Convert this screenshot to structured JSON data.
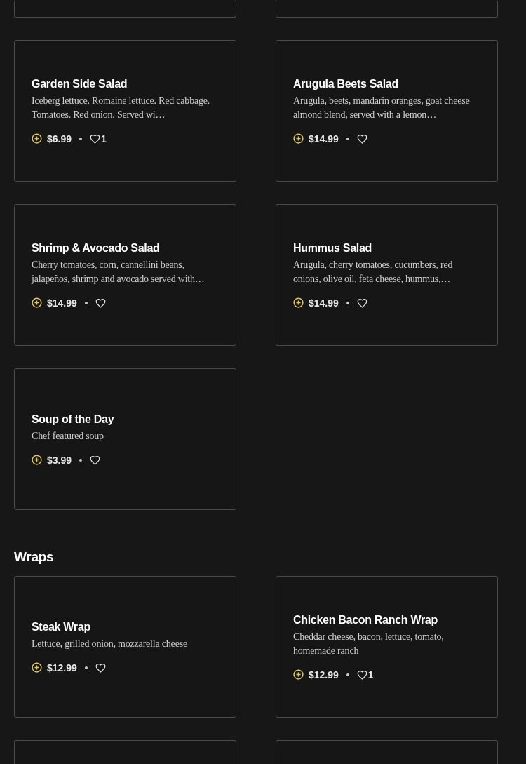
{
  "sections": [
    {
      "items": [
        {
          "kind": "partial"
        },
        {
          "kind": "partial"
        },
        {
          "kind": "full",
          "name": "Garden Side Salad",
          "description": "Iceberg lettuce. Romaine lettuce. Red cabbage. Tomatoes. Red onion. Served wi…",
          "price": "$6.99",
          "likes": "1"
        },
        {
          "kind": "full",
          "name": "Arugula Beets Salad",
          "description": "Arugula, beets, mandarin oranges, goat cheese almond blend, served with a lemon…",
          "price": "$14.99"
        },
        {
          "kind": "full",
          "name": "Shrimp & Avocado Salad",
          "description": "Cherry tomatoes, corn, cannellini beans, jalapeños, shrimp and avocado served with…",
          "price": "$14.99"
        },
        {
          "kind": "full",
          "name": "Hummus Salad",
          "description": "Arugula, cherry tomatoes, cucumbers, red onions, olive oil, feta cheese, hummus,…",
          "price": "$14.99"
        },
        {
          "kind": "full",
          "name": "Soup of the Day",
          "description": "Chef featured soup",
          "price": "$3.99"
        }
      ]
    },
    {
      "title": "Wraps",
      "items": [
        {
          "kind": "full",
          "name": "Steak Wrap",
          "description": "Lettuce, grilled onion, mozzarella cheese",
          "price": "$12.99"
        },
        {
          "kind": "full",
          "name": "Chicken Bacon Ranch Wrap",
          "description": "Cheddar cheese, bacon, lettuce, tomato, homemade ranch",
          "price": "$12.99",
          "likes": "1"
        },
        {
          "kind": "partial"
        },
        {
          "kind": "partial"
        }
      ]
    }
  ]
}
